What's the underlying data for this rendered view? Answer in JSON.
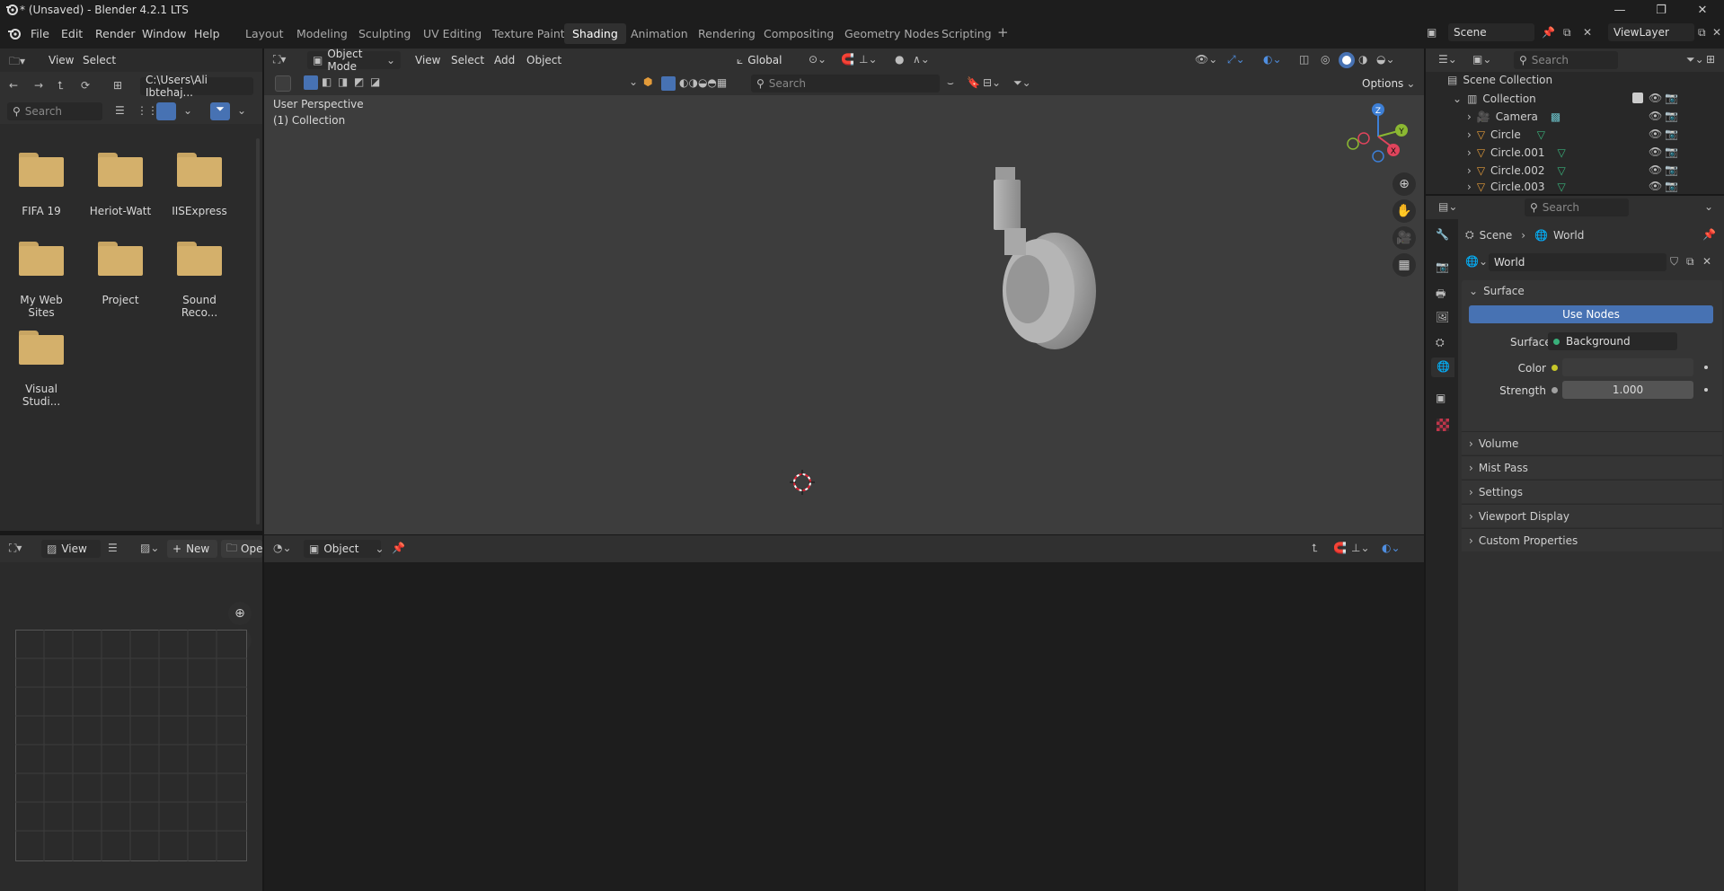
{
  "window": {
    "title": "* (Unsaved) - Blender 4.2.1 LTS",
    "minimize": "—",
    "maximize": "❐",
    "close": "✕"
  },
  "menu": {
    "file": "File",
    "edit": "Edit",
    "render": "Render",
    "window": "Window",
    "help": "Help"
  },
  "workspaces": [
    "Layout",
    "Modeling",
    "Sculpting",
    "UV Editing",
    "Texture Paint",
    "Shading",
    "Animation",
    "Rendering",
    "Compositing",
    "Geometry Nodes",
    "Scripting"
  ],
  "active_workspace": "Shading",
  "scene": {
    "name": "Scene",
    "view_layer": "ViewLayer"
  },
  "file_browser": {
    "view": "View",
    "select": "Select",
    "path": "C:\\Users\\Ali Ibtehaj...",
    "search_placeholder": "Search",
    "folders": [
      "FIFA 19",
      "Heriot-Watt",
      "IISExpress",
      "My Web Sites",
      "Project",
      "Sound Reco...",
      "Visual Studi..."
    ]
  },
  "viewport": {
    "mode": "Object Mode",
    "view": "View",
    "select": "Select",
    "add": "Add",
    "object": "Object",
    "orientation": "Global",
    "options": "Options",
    "search_placeholder": "Search",
    "perspective": "User Perspective",
    "collection": "(1) Collection",
    "gizmo": {
      "x": "X",
      "y": "Y",
      "z": "Z"
    }
  },
  "image_editor": {
    "view": "View",
    "new": "New",
    "open": "Ope"
  },
  "node_editor": {
    "object": "Object"
  },
  "outliner": {
    "search_placeholder": "Search",
    "scene_collection": "Scene Collection",
    "collection": "Collection",
    "items": [
      "Camera",
      "Circle",
      "Circle.001",
      "Circle.002",
      "Circle.003"
    ]
  },
  "properties": {
    "search_placeholder": "Search",
    "breadcrumb_scene": "Scene",
    "breadcrumb_world": "World",
    "world_name": "World",
    "surface_panel": "Surface",
    "use_nodes": "Use Nodes",
    "surface_label": "Surface",
    "surface_value": "Background",
    "color_label": "Color",
    "strength_label": "Strength",
    "strength_value": "1.000",
    "sections": [
      "Volume",
      "Mist Pass",
      "Settings",
      "Viewport Display",
      "Custom Properties"
    ]
  },
  "colors": {
    "accent": "#4772b3",
    "folder": "#d4b06b",
    "axis_x": "#e0445c",
    "axis_y": "#8bb832",
    "axis_z": "#3d7fd6"
  }
}
